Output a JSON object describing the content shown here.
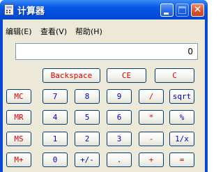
{
  "window": {
    "title": "计算器",
    "title_color": "#ffffff",
    "titlebar_color": "#0a5ae6"
  },
  "titlebar_buttons": {
    "close_glyph": "✕"
  },
  "menu": {
    "items": [
      "编辑(E)",
      "查看(V)",
      "帮助(H)"
    ]
  },
  "display": {
    "value": "0"
  },
  "buttons": {
    "backspace": "Backspace",
    "ce": "CE",
    "c": "C",
    "mc": "MC",
    "mr": "MR",
    "ms": "MS",
    "mplus": "M+",
    "d7": "7",
    "d8": "8",
    "d9": "9",
    "divide": "/",
    "sqrt": "sqrt",
    "d4": "4",
    "d5": "5",
    "d6": "6",
    "multiply": "*",
    "percent": "%",
    "d1": "1",
    "d2": "2",
    "d3": "3",
    "minus": "-",
    "reciprocal": "1/x",
    "d0": "0",
    "sign": "+/-",
    "dot": ".",
    "plus": "+",
    "equals": "="
  },
  "colors": {
    "operator_text": "#e00000",
    "digit_text": "#0000c0",
    "button_border": "#003c74",
    "face": "#ece9d8"
  }
}
